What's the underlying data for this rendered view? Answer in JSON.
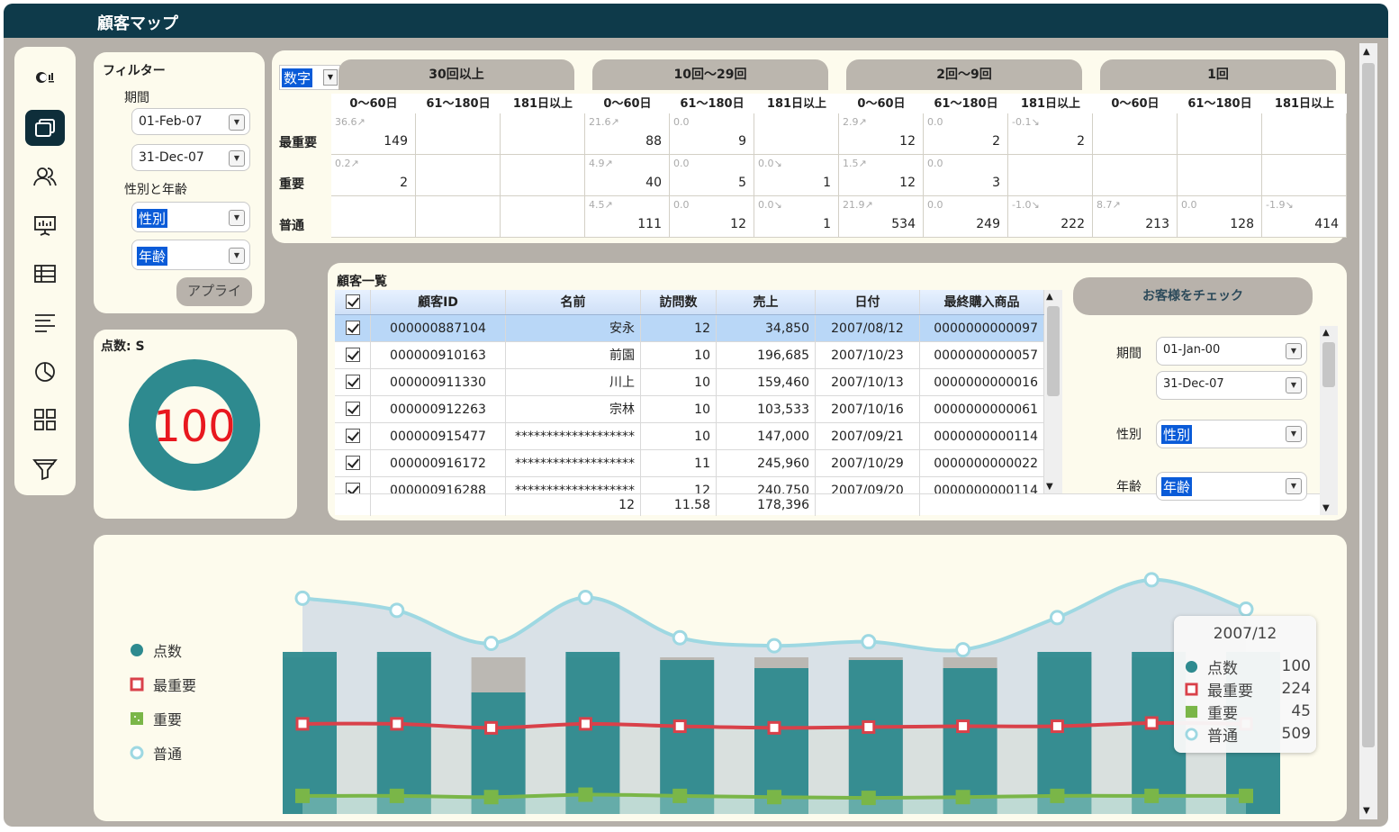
{
  "app": {
    "title": "顧客マップ"
  },
  "rail": {
    "items": [
      "summary",
      "cards",
      "users",
      "presentation",
      "table",
      "list",
      "pie",
      "grid",
      "funnel"
    ]
  },
  "filter": {
    "title": "フィルター",
    "period_label": "期間",
    "date_from": "01-Feb-07",
    "date_to": "31-Dec-07",
    "gender_age_label": "性別と年齢",
    "gender": "性別",
    "age": "年齢",
    "apply_label": "アプライ"
  },
  "score": {
    "title": "点数: S",
    "value": "100",
    "value_fraction": 1.0,
    "color": "#2e8a8f"
  },
  "matrix": {
    "mode": "数字",
    "groups": [
      "30回以上",
      "10回～29回",
      "2回～9回",
      "1回"
    ],
    "subcols": [
      "0～60日",
      "61～180日",
      "181日以上"
    ],
    "rows": [
      {
        "label": "最重要",
        "cells": [
          {
            "sub": "36.6↗",
            "num": "149"
          },
          {
            "sub": "",
            "num": ""
          },
          {
            "sub": "",
            "num": ""
          },
          {
            "sub": "21.6↗",
            "num": "88"
          },
          {
            "sub": "0.0",
            "num": "9"
          },
          {
            "sub": "",
            "num": ""
          },
          {
            "sub": "2.9↗",
            "num": "12"
          },
          {
            "sub": "0.0",
            "num": "2"
          },
          {
            "sub": "-0.1↘",
            "num": "2"
          },
          {
            "sub": "",
            "num": ""
          },
          {
            "sub": "",
            "num": ""
          },
          {
            "sub": "",
            "num": ""
          }
        ]
      },
      {
        "label": "重要",
        "cells": [
          {
            "sub": "0.2↗",
            "num": "2"
          },
          {
            "sub": "",
            "num": ""
          },
          {
            "sub": "",
            "num": ""
          },
          {
            "sub": "4.9↗",
            "num": "40"
          },
          {
            "sub": "0.0",
            "num": "5"
          },
          {
            "sub": "0.0↘",
            "num": "1"
          },
          {
            "sub": "1.5↗",
            "num": "12"
          },
          {
            "sub": "0.0",
            "num": "3"
          },
          {
            "sub": "",
            "num": ""
          },
          {
            "sub": "",
            "num": ""
          },
          {
            "sub": "",
            "num": ""
          },
          {
            "sub": "",
            "num": ""
          }
        ]
      },
      {
        "label": "普通",
        "cells": [
          {
            "sub": "",
            "num": ""
          },
          {
            "sub": "",
            "num": ""
          },
          {
            "sub": "",
            "num": ""
          },
          {
            "sub": "4.5↗",
            "num": "111"
          },
          {
            "sub": "0.0",
            "num": "12"
          },
          {
            "sub": "0.0↘",
            "num": "1"
          },
          {
            "sub": "21.9↗",
            "num": "534"
          },
          {
            "sub": "0.0",
            "num": "249"
          },
          {
            "sub": "-1.0↘",
            "num": "222"
          },
          {
            "sub": "8.7↗",
            "num": "213"
          },
          {
            "sub": "0.0",
            "num": "128"
          },
          {
            "sub": "-1.9↘",
            "num": "414"
          }
        ]
      }
    ]
  },
  "customers": {
    "title": "顧客一覧",
    "columns": [
      "顧客ID",
      "名前",
      "訪問数",
      "売上",
      "日付",
      "最終購入商品"
    ],
    "rows": [
      {
        "id": "000000887104",
        "name": "安永",
        "visits": "12",
        "sales": "34,850",
        "date": "2007/08/12",
        "product": "0000000000097"
      },
      {
        "id": "000000910163",
        "name": "前園",
        "visits": "10",
        "sales": "196,685",
        "date": "2007/10/23",
        "product": "0000000000057"
      },
      {
        "id": "000000911330",
        "name": "川上",
        "visits": "10",
        "sales": "159,460",
        "date": "2007/10/13",
        "product": "0000000000016"
      },
      {
        "id": "000000912263",
        "name": "宗林",
        "visits": "10",
        "sales": "103,533",
        "date": "2007/10/16",
        "product": "0000000000061"
      },
      {
        "id": "000000915477",
        "name": "*******************",
        "visits": "10",
        "sales": "147,000",
        "date": "2007/09/21",
        "product": "0000000000114"
      },
      {
        "id": "000000916172",
        "name": "*******************",
        "visits": "11",
        "sales": "245,960",
        "date": "2007/10/29",
        "product": "0000000000022"
      },
      {
        "id": "000000916288",
        "name": "*******************",
        "visits": "12",
        "sales": "240,750",
        "date": "2007/09/20",
        "product": "0000000000114"
      }
    ],
    "footer": {
      "count": "12",
      "avg_visits": "11.58",
      "total_sales": "178,396"
    }
  },
  "check": {
    "button_label": "お客様をチェック",
    "period_label": "期間",
    "date_from": "01-Jan-00",
    "date_to": "31-Dec-07",
    "gender_label": "性別",
    "gender": "性別",
    "age_label": "年齢",
    "age": "年齢"
  },
  "chart_data": {
    "type": "bar",
    "series": [
      {
        "name": "点数",
        "color": "#2e8a8f",
        "values": [
          100,
          100,
          75,
          100,
          95,
          90,
          95,
          90,
          100,
          100,
          100
        ]
      },
      {
        "name": "最重要",
        "color": "#d9414a",
        "values": [
          224,
          224,
          214,
          224,
          218,
          214,
          216,
          218,
          218,
          226,
          224
        ]
      },
      {
        "name": "重要",
        "color": "#7ab648",
        "values": [
          45,
          45,
          42,
          48,
          45,
          42,
          40,
          42,
          45,
          45,
          45
        ]
      },
      {
        "name": "普通",
        "color": "#9ed8e2",
        "values": [
          536,
          506,
          424,
          538,
          438,
          418,
          428,
          408,
          488,
          582,
          509
        ]
      }
    ],
    "tooltip": {
      "title": "2007/12",
      "values": [
        "100",
        "224",
        "45",
        "509"
      ]
    }
  }
}
